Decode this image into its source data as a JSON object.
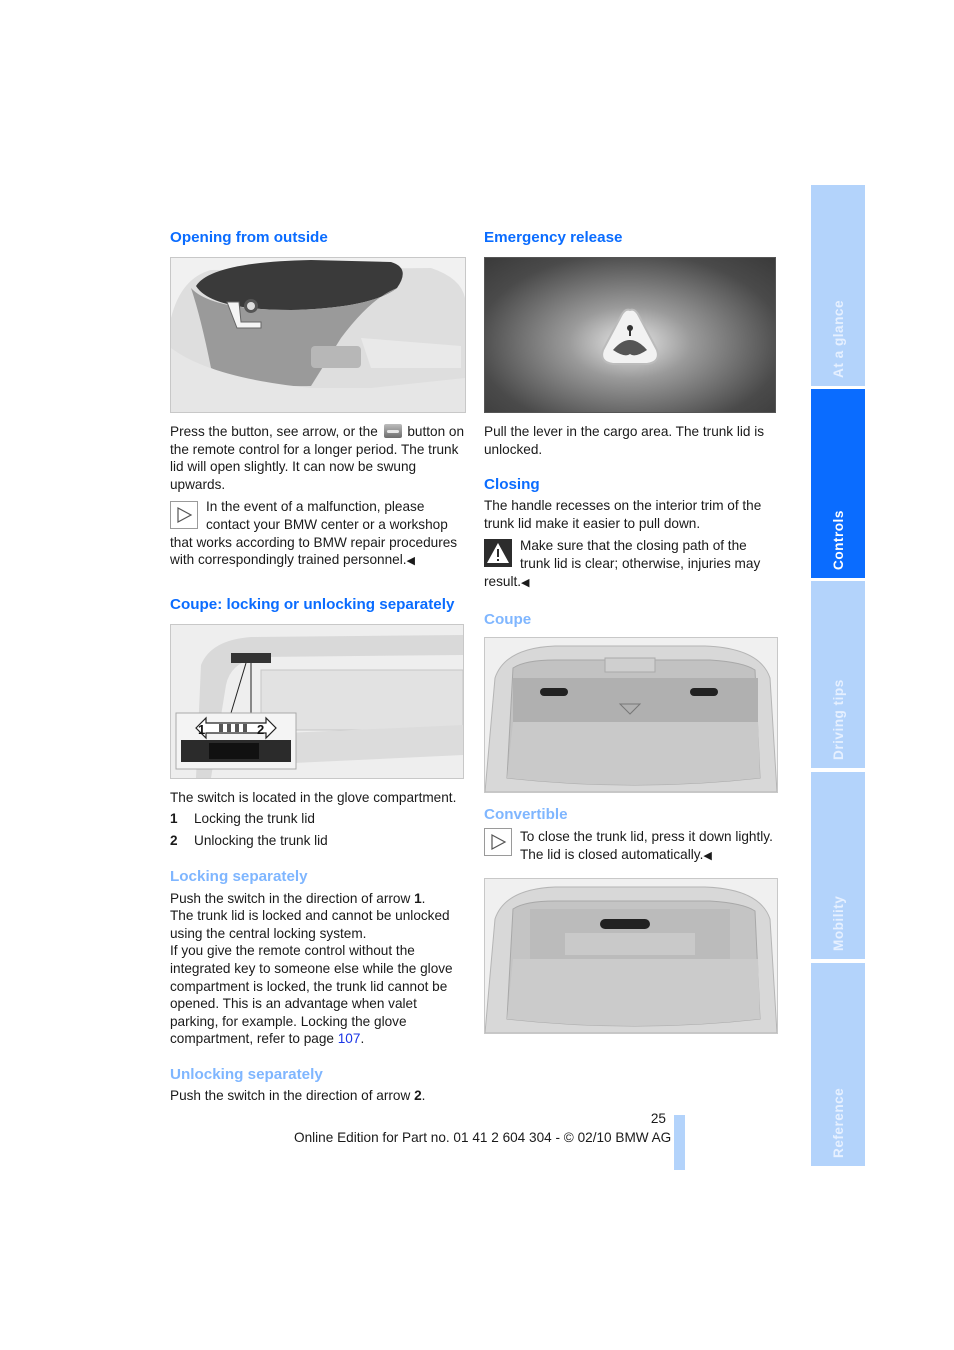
{
  "left": {
    "opening": {
      "title": "Opening from outside",
      "p1_a": "Press the button, see arrow, or the",
      "p1_b": "button on the remote control for a longer period. The trunk lid will open slightly. It can now be swung upwards.",
      "note": "In the event of a malfunction, please contact your BMW center or a workshop that works according to BMW repair procedures with correspondingly trained personnel."
    },
    "coupe_lock": {
      "title": "Coupe: locking or unlocking separately",
      "callout_1": "1",
      "callout_2": "2",
      "switch_location": "The switch is located in the glove compartment.",
      "list": [
        {
          "num": "1",
          "text": "Locking the trunk lid"
        },
        {
          "num": "2",
          "text": "Unlocking the trunk lid"
        }
      ]
    },
    "locking": {
      "title": "Locking separately",
      "p1_a": "Push the switch in the direction of arrow ",
      "p1_b": "1",
      "p1_c": ".",
      "p2": "The trunk lid is locked and cannot be unlocked using the central locking system.",
      "p3_a": "If you give the remote control without the integrated key to someone else while the glove compartment is locked, the trunk lid cannot be opened. This is an advantage when valet parking, for example. Locking the glove compartment, refer to page ",
      "p3_link": "107",
      "p3_c": "."
    },
    "unlocking": {
      "title": "Unlocking separately",
      "p1_a": "Push the switch in the direction of arrow ",
      "p1_b": "2",
      "p1_c": "."
    }
  },
  "right": {
    "emergency": {
      "title": "Emergency release",
      "text": "Pull the lever in the cargo area. The trunk lid is unlocked."
    },
    "closing": {
      "title": "Closing",
      "text": "The handle recesses on the interior trim of the trunk lid make it easier to pull down.",
      "warning": "Make sure that the closing path of the trunk lid is clear; otherwise, injuries may result."
    },
    "coupe": {
      "title": "Coupe"
    },
    "convertible": {
      "title": "Convertible",
      "note": "To close the trunk lid, press it down lightly. The lid is closed automatically."
    }
  },
  "end_mark": "◀",
  "side_tabs": [
    {
      "label": "At a glance",
      "active": false
    },
    {
      "label": "Controls",
      "active": true
    },
    {
      "label": "Driving tips",
      "active": false
    },
    {
      "label": "Mobility",
      "active": false
    },
    {
      "label": "Reference",
      "active": false
    }
  ],
  "footer": {
    "page_number": "25",
    "edition": "Online Edition for Part no. 01 41 2 604 304 - © 02/10 BMW AG"
  },
  "colors": {
    "heading": "#0a6cff",
    "subheading": "#7fb6ff",
    "tab_active": "#0a6cff",
    "tab_inactive": "#b3d3fb",
    "link": "#1a35e6"
  }
}
